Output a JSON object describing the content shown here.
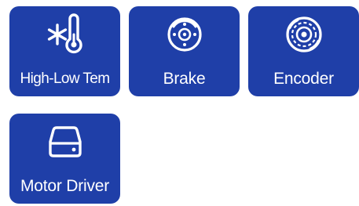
{
  "tiles": [
    {
      "label": "High-Low Tem",
      "icon": "snowflake-thermometer-icon"
    },
    {
      "label": "Brake",
      "icon": "brake-disc-icon"
    },
    {
      "label": "Encoder",
      "icon": "encoder-disc-icon"
    },
    {
      "label": "Motor Driver",
      "icon": "hard-drive-icon"
    }
  ],
  "colors": {
    "tile_background": "#1f3fa8",
    "tile_foreground": "#ffffff",
    "page_background": "#ffffff"
  }
}
